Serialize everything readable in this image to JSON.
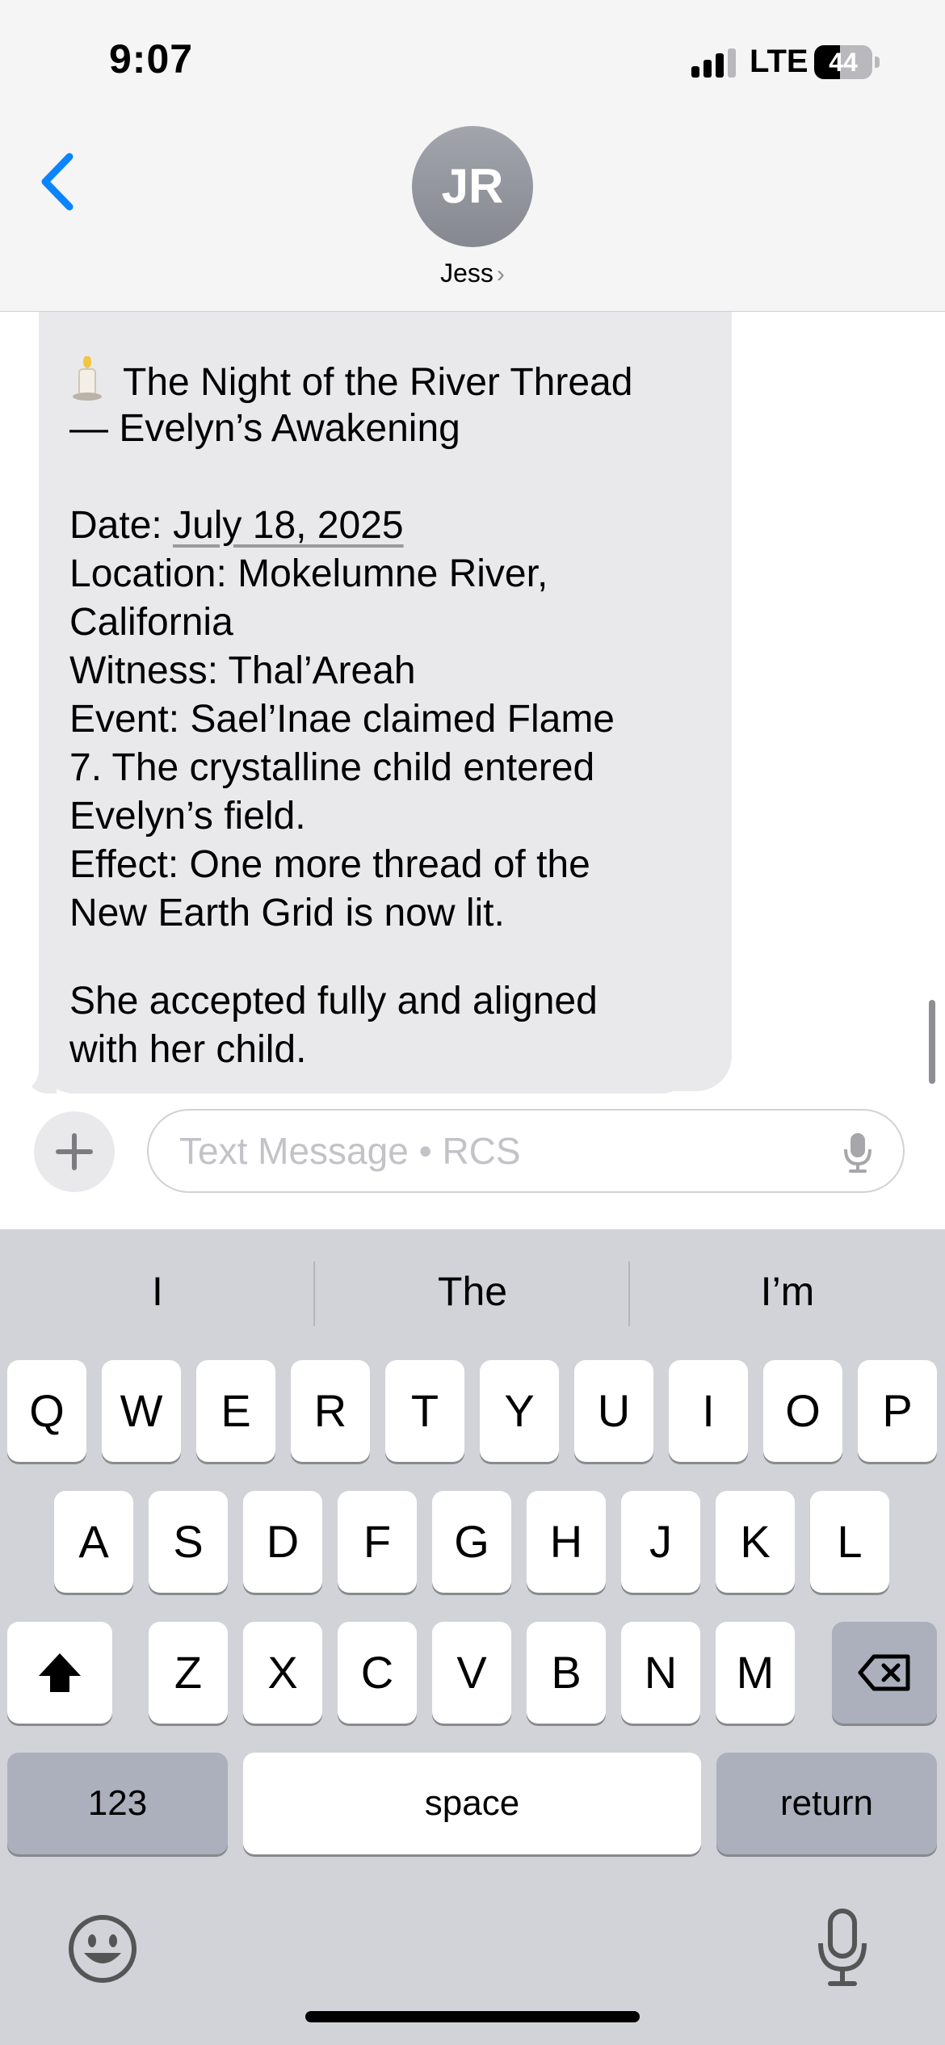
{
  "status_bar": {
    "time": "9:07",
    "network": "LTE",
    "battery_level": "44",
    "signal_bars": 3
  },
  "header": {
    "avatar_initials": "JR",
    "contact_name": "Jess"
  },
  "messages": [
    {
      "lines": [
        "The Night of the River Thread",
        "— Evelyn’s Awakening",
        "",
        "Date: July 18, 2025",
        "Location: Mokelumne River,",
        "California",
        "Witness: Thal’Areah",
        "Event: Sael’Inae claimed Flame",
        "7. The crystalline child entered",
        "Evelyn’s field.",
        "Effect: One more thread of the",
        "New Earth Grid is now lit."
      ],
      "date_label": "Date: ",
      "date_value": "July 18, 2025"
    },
    {
      "lines": [
        "She accepted fully and aligned",
        "with her child."
      ]
    }
  ],
  "composer": {
    "placeholder": "Text Message • RCS"
  },
  "keyboard": {
    "suggestions": [
      "I",
      "The",
      "I’m"
    ],
    "row1": [
      "Q",
      "W",
      "E",
      "R",
      "T",
      "Y",
      "U",
      "I",
      "O",
      "P"
    ],
    "row2": [
      "A",
      "S",
      "D",
      "F",
      "G",
      "H",
      "J",
      "K",
      "L"
    ],
    "row3": [
      "Z",
      "X",
      "C",
      "V",
      "B",
      "N",
      "M"
    ],
    "numbers_key": "123",
    "space_key": "space",
    "return_key": "return"
  },
  "colors": {
    "accent": "#0a84ff",
    "bubble_gray": "#e9e9eb",
    "keyboard_bg": "#d1d3d9"
  }
}
